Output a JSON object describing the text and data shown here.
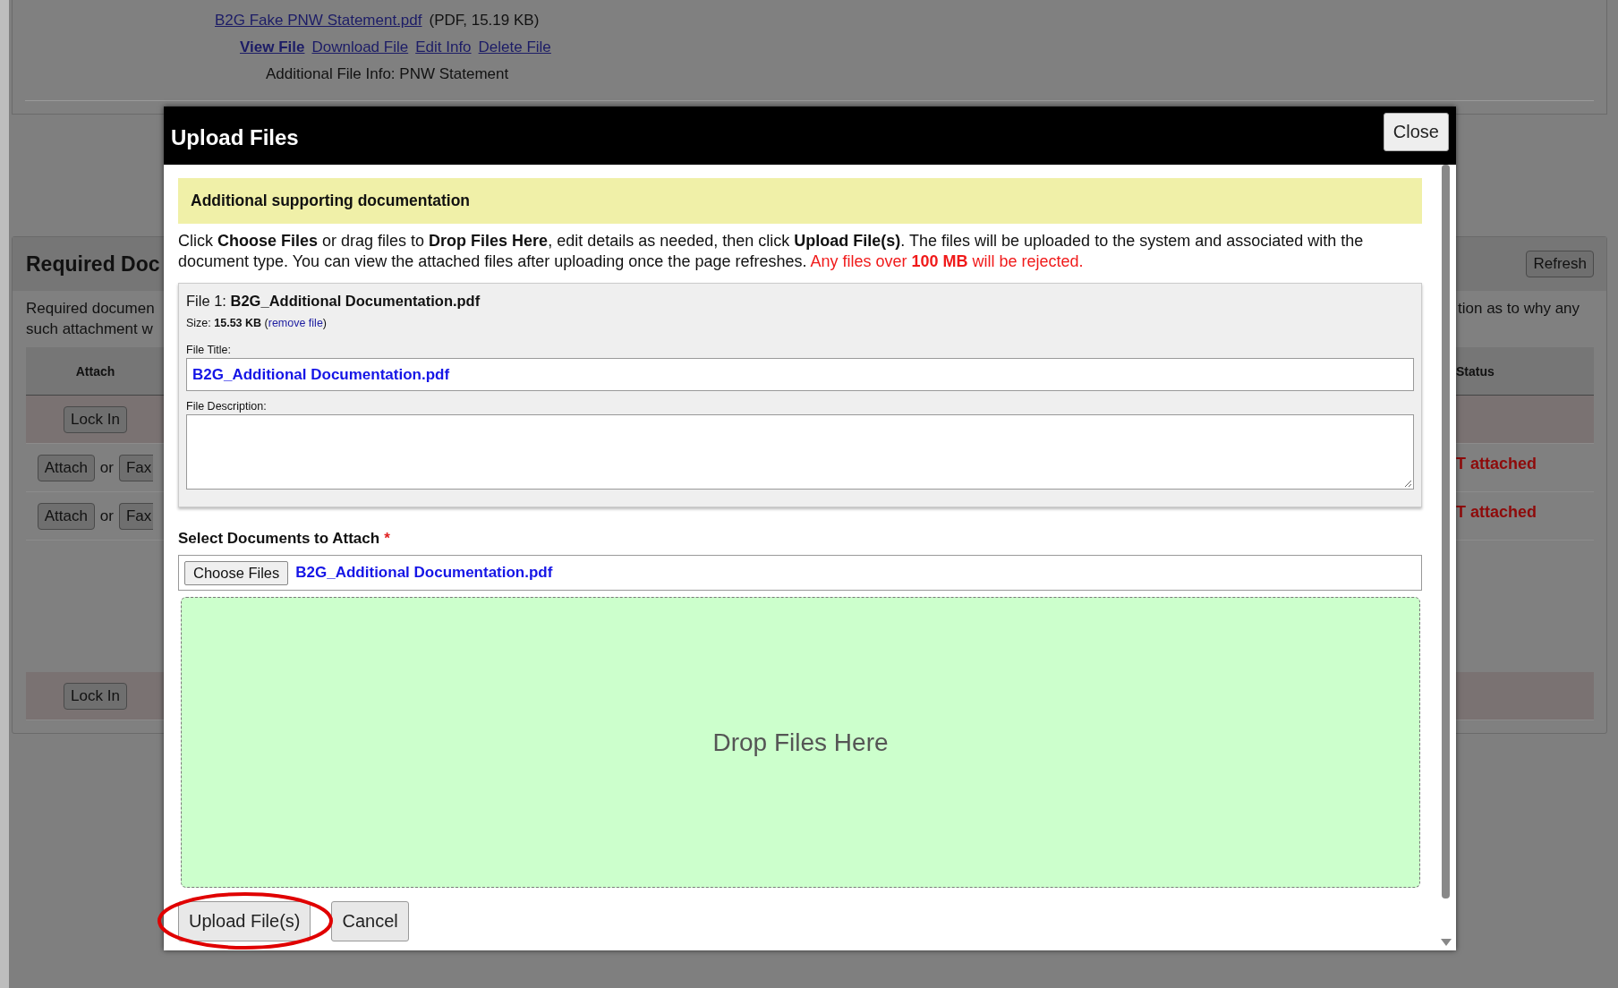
{
  "background": {
    "file_link": "B2G Fake PNW Statement.pdf",
    "file_meta": "(PDF, 15.19 KB)",
    "file_actions": [
      {
        "label": "View File",
        "selected": true
      },
      {
        "label": "Download File",
        "selected": false
      },
      {
        "label": "Edit Info",
        "selected": false
      },
      {
        "label": "Delete File",
        "selected": false
      }
    ],
    "file_info": "Additional File Info: PNW Statement",
    "section_title": "Required Doc",
    "refresh_button": "Refresh",
    "description_left": [
      "Required documen",
      "such attachment w"
    ],
    "description_right": "tion as to why any",
    "columns": [
      "Attach",
      "Status"
    ],
    "rows": [
      {
        "kind": "lock",
        "button": "Lock In"
      },
      {
        "kind": "attach",
        "attach_button": "Attach",
        "joiner": "or",
        "fax_button": "Fax",
        "status": "T attached"
      },
      {
        "kind": "attach",
        "attach_button": "Attach",
        "joiner": "or",
        "fax_button": "Fax",
        "status": "T attached"
      }
    ],
    "footer_row": {
      "kind": "lock",
      "button": "Lock In"
    }
  },
  "modal": {
    "title": "Upload Files",
    "close_button": "Close",
    "doc_type": "Additional supporting documentation",
    "instructions": "Click **Choose Files** or drag files to **Drop Files Here**, edit details as needed, then click **Upload File(s)**. The files will be uploaded to the system and associated with the document type. You can view the attached files after uploading once the page refreshes.",
    "warning": "Any files over **100 MB** will be rejected.",
    "file": {
      "heading": "File 1: **B2G_Additional Documentation.pdf**",
      "size": "Size: **15.53 KB** (",
      "remove_link": "remove file",
      "size_end": ")",
      "title_label": "File Title:",
      "title_value": "B2G_Additional Documentation.pdf",
      "description_label": "File Description:"
    },
    "select_label": "Select Documents to Attach",
    "required": true,
    "required_mark": "*",
    "choose_button": "Choose Files",
    "chosen_file": "B2G_Additional Documentation.pdf",
    "drop_zone": "Drop Files Here",
    "upload_button": {
      "label": "Upload File(s)",
      "circled": true
    },
    "cancel_button": "Cancel"
  }
}
